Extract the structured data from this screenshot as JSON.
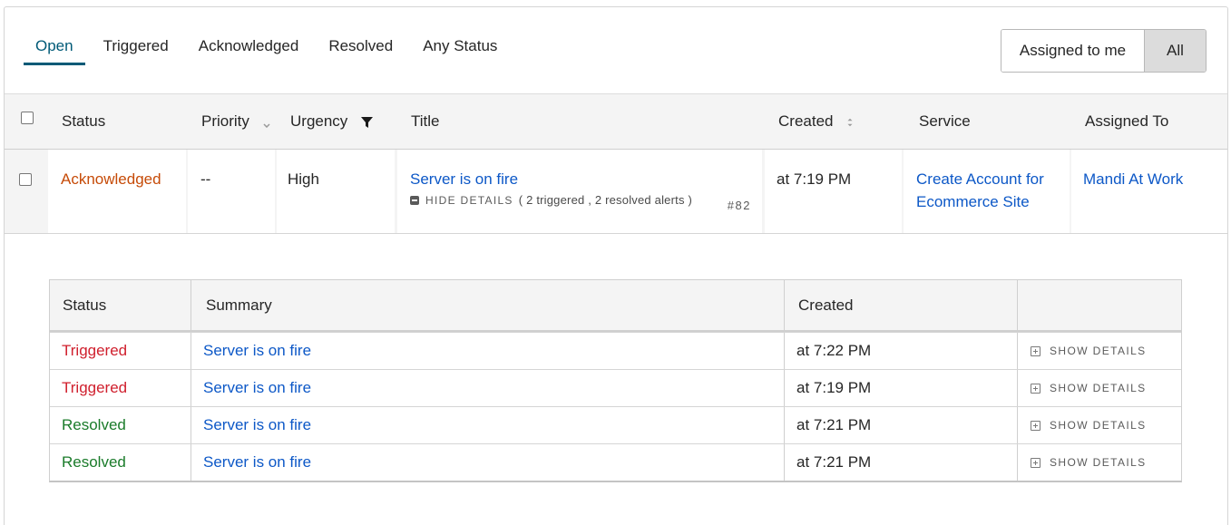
{
  "tabs": [
    {
      "label": "Open",
      "active": true
    },
    {
      "label": "Triggered",
      "active": false
    },
    {
      "label": "Acknowledged",
      "active": false
    },
    {
      "label": "Resolved",
      "active": false
    },
    {
      "label": "Any Status",
      "active": false
    }
  ],
  "assign_toggle": {
    "mine_label": "Assigned to me",
    "all_label": "All",
    "selected": "All"
  },
  "incident_table": {
    "headers": {
      "status": "Status",
      "priority": "Priority",
      "urgency": "Urgency",
      "title": "Title",
      "created": "Created",
      "service": "Service",
      "assigned_to": "Assigned To"
    },
    "rows": [
      {
        "status": "Acknowledged",
        "priority": "--",
        "urgency": "High",
        "title": "Server is on fire",
        "hide_details_label": "HIDE DETAILS",
        "alerts_note": "( 2 triggered , 2 resolved alerts )",
        "incident_number": "#82",
        "created": "at 7:19 PM",
        "service_line1": "Create Account for",
        "service_line2": "Ecommerce Site",
        "assigned_to": "Mandi At Work"
      }
    ]
  },
  "alerts_table": {
    "headers": {
      "status": "Status",
      "summary": "Summary",
      "created": "Created"
    },
    "show_details_label": "SHOW DETAILS",
    "rows": [
      {
        "status": "Triggered",
        "summary": "Server is on fire",
        "created": "at 7:22 PM"
      },
      {
        "status": "Triggered",
        "summary": "Server is on fire",
        "created": "at 7:19 PM"
      },
      {
        "status": "Resolved",
        "summary": "Server is on fire",
        "created": "at 7:21 PM"
      },
      {
        "status": "Resolved",
        "summary": "Server is on fire",
        "created": "at 7:21 PM"
      }
    ]
  },
  "colors": {
    "active_tab": "#005a77",
    "link": "#0d58c7",
    "acknowledged": "#c64b08",
    "triggered": "#d0202e",
    "resolved": "#1a7b2a"
  }
}
